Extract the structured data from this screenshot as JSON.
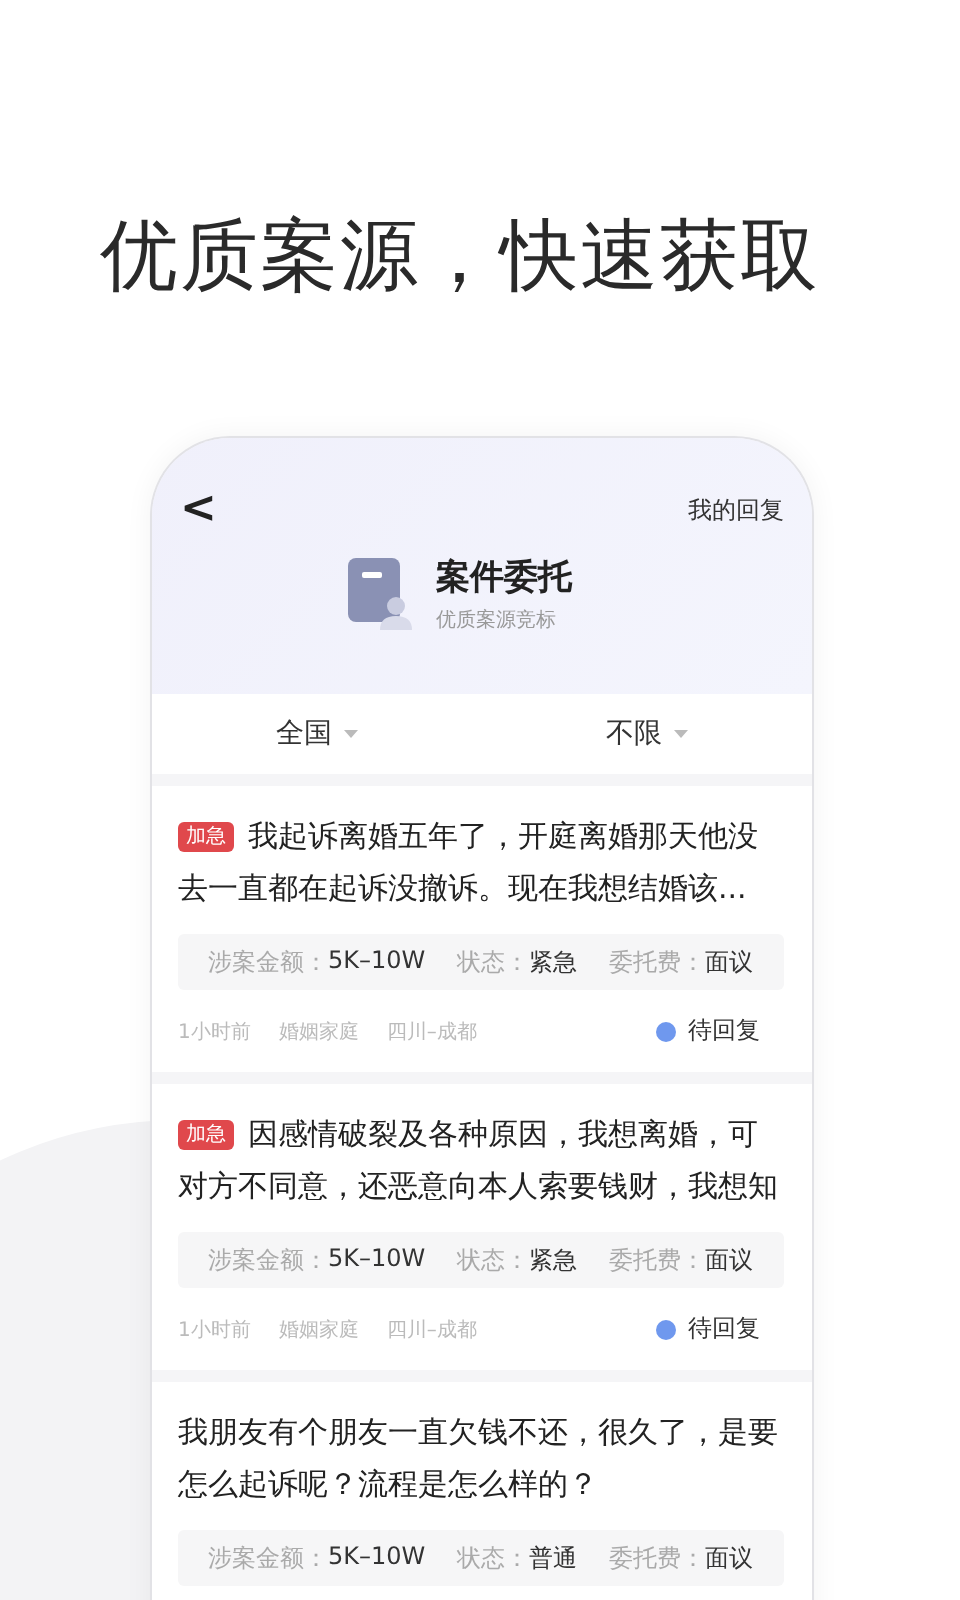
{
  "headline": "优质案源，快速获取",
  "header": {
    "back": "<",
    "link": "我的回复",
    "title": "案件委托",
    "subtitle": "优质案源竞标"
  },
  "filters": [
    {
      "label": "全国"
    },
    {
      "label": "不限"
    }
  ],
  "cases": [
    {
      "tag": "加急",
      "text": "我起诉离婚五年了，开庭离婚那天他没去一直都在起诉没撤诉。现在我想结婚该...",
      "fields": [
        {
          "label": "涉案金额：",
          "value": "5K–10W"
        },
        {
          "label": "状态：",
          "value": "紧急"
        },
        {
          "label": "委托费：",
          "value": "面议"
        }
      ],
      "meta": [
        "1小时前",
        "婚姻家庭",
        "四川–成都"
      ],
      "status": {
        "label": "待回复",
        "color": "#6f98ee"
      }
    },
    {
      "tag": "加急",
      "text": "因感情破裂及各种原因，我想离婚，可对方不同意，还恶意向本人索要钱财，我想知",
      "fields": [
        {
          "label": "涉案金额：",
          "value": "5K–10W"
        },
        {
          "label": "状态：",
          "value": "紧急"
        },
        {
          "label": "委托费：",
          "value": "面议"
        }
      ],
      "meta": [
        "1小时前",
        "婚姻家庭",
        "四川–成都"
      ],
      "status": {
        "label": "待回复",
        "color": "#6f98ee"
      }
    },
    {
      "text": "我朋友有个朋友一直欠钱不还，很久了，是要怎么起诉呢？流程是怎么样的？",
      "fields": [
        {
          "label": "涉案金额：",
          "value": "5K–10W"
        },
        {
          "label": "状态：",
          "value": "普通"
        },
        {
          "label": "委托费：",
          "value": "面议"
        }
      ]
    }
  ]
}
